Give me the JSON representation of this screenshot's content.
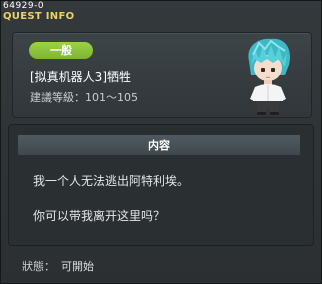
{
  "window": {
    "quest_id": "64929-0",
    "title": "QUEST INFO"
  },
  "quest": {
    "category": "一般",
    "name": "[拟真机器人3]牺牲",
    "level_label": "建議等級",
    "level_range": "101～105"
  },
  "content": {
    "header": "内容",
    "lines": [
      "我一个人无法逃出阿特利埃。",
      "你可以带我离开这里吗？"
    ]
  },
  "status": {
    "label": "狀態：",
    "value": "可開始"
  },
  "colors": {
    "title": "#e8d36a",
    "badge": "#8ec43c",
    "background": "#2d3133"
  },
  "icons": {
    "portrait": "npc-portrait-icon"
  }
}
